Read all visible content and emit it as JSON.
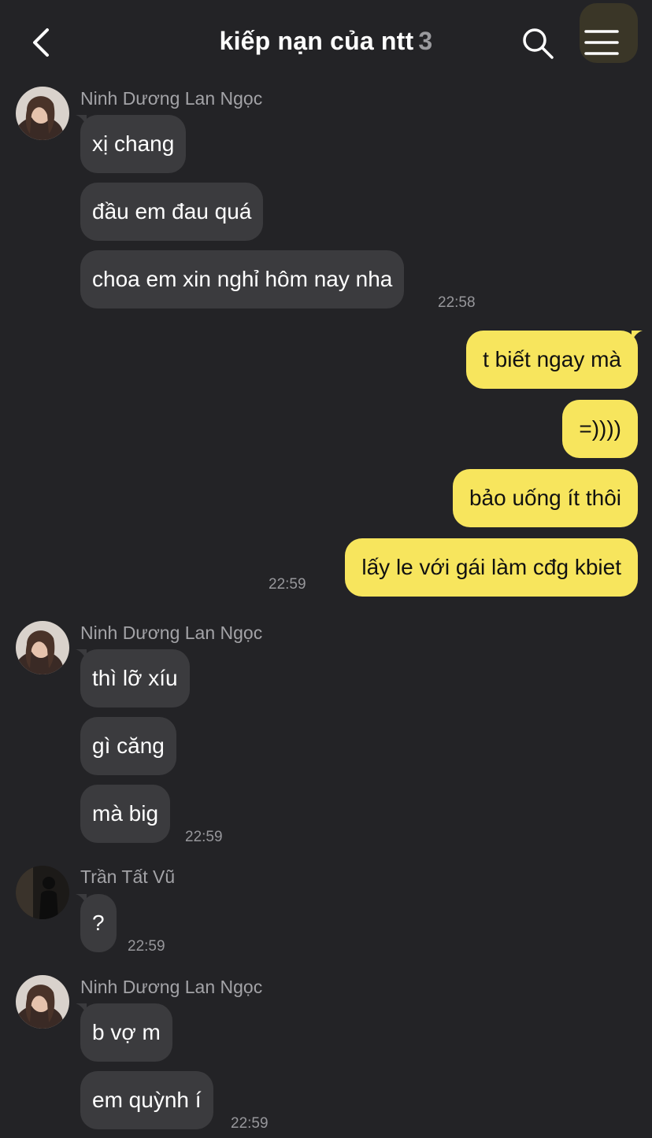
{
  "header": {
    "title": "kiếp nạn của ntt",
    "member_count": "3"
  },
  "colors": {
    "background": "#232326",
    "incoming_bubble": "#3b3b3e",
    "outgoing_bubble": "#f7e55d",
    "timestamp": "#97979b"
  },
  "icons": [
    "back-arrow-icon",
    "search-icon",
    "menu-icon"
  ],
  "groups": [
    {
      "sender": "Ninh Dương Lan Ngọc",
      "messages": [
        "xị chang",
        "đầu em đau quá",
        "choa em xin nghỉ hôm nay nha"
      ],
      "time": "22:58"
    },
    {
      "sender": "",
      "outgoing": true,
      "messages": [
        "t biết ngay mà",
        "=))))",
        "bảo uống ít thôi",
        "lấy le với gái làm cđg kbiet"
      ],
      "time": "22:59"
    },
    {
      "sender": "Ninh Dương Lan Ngọc",
      "messages": [
        "thì lỡ xíu",
        "gì căng",
        "mà big"
      ],
      "time": "22:59"
    },
    {
      "sender": "Trần Tất Vũ",
      "messages": [
        "?"
      ],
      "time": "22:59"
    },
    {
      "sender": "Ninh Dương Lan Ngọc",
      "messages": [
        "b vợ m",
        "em quỳnh í"
      ],
      "time": "22:59"
    }
  ]
}
